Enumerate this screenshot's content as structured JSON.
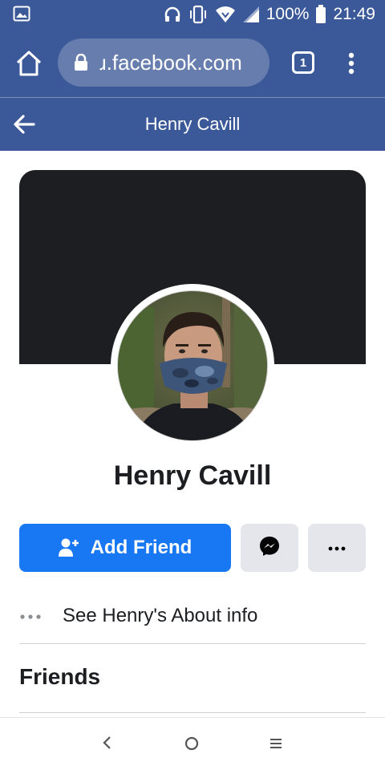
{
  "status_bar": {
    "battery": "100%",
    "time": "21:49"
  },
  "browser": {
    "url": "ɹ.facebook.com",
    "tab_count": "1"
  },
  "header": {
    "title": "Henry Cavill"
  },
  "profile": {
    "name": "Henry Cavill",
    "cover_color": "#1c1e21"
  },
  "actions": {
    "add_friend_label": "Add Friend",
    "accent_color": "#1877f2"
  },
  "about": {
    "label": "See Henry's About info"
  },
  "sections": {
    "friends_title": "Friends"
  },
  "icons": [
    "gallery-icon",
    "headphones-icon",
    "vibrate-icon",
    "wifi-icon",
    "signal-icon",
    "battery-icon",
    "home-icon",
    "lock-icon",
    "more-vert-icon",
    "back-arrow-icon",
    "add-friend-icon",
    "messenger-icon",
    "more-horiz-icon",
    "nav-back-icon",
    "nav-home-icon",
    "nav-recent-icon"
  ]
}
